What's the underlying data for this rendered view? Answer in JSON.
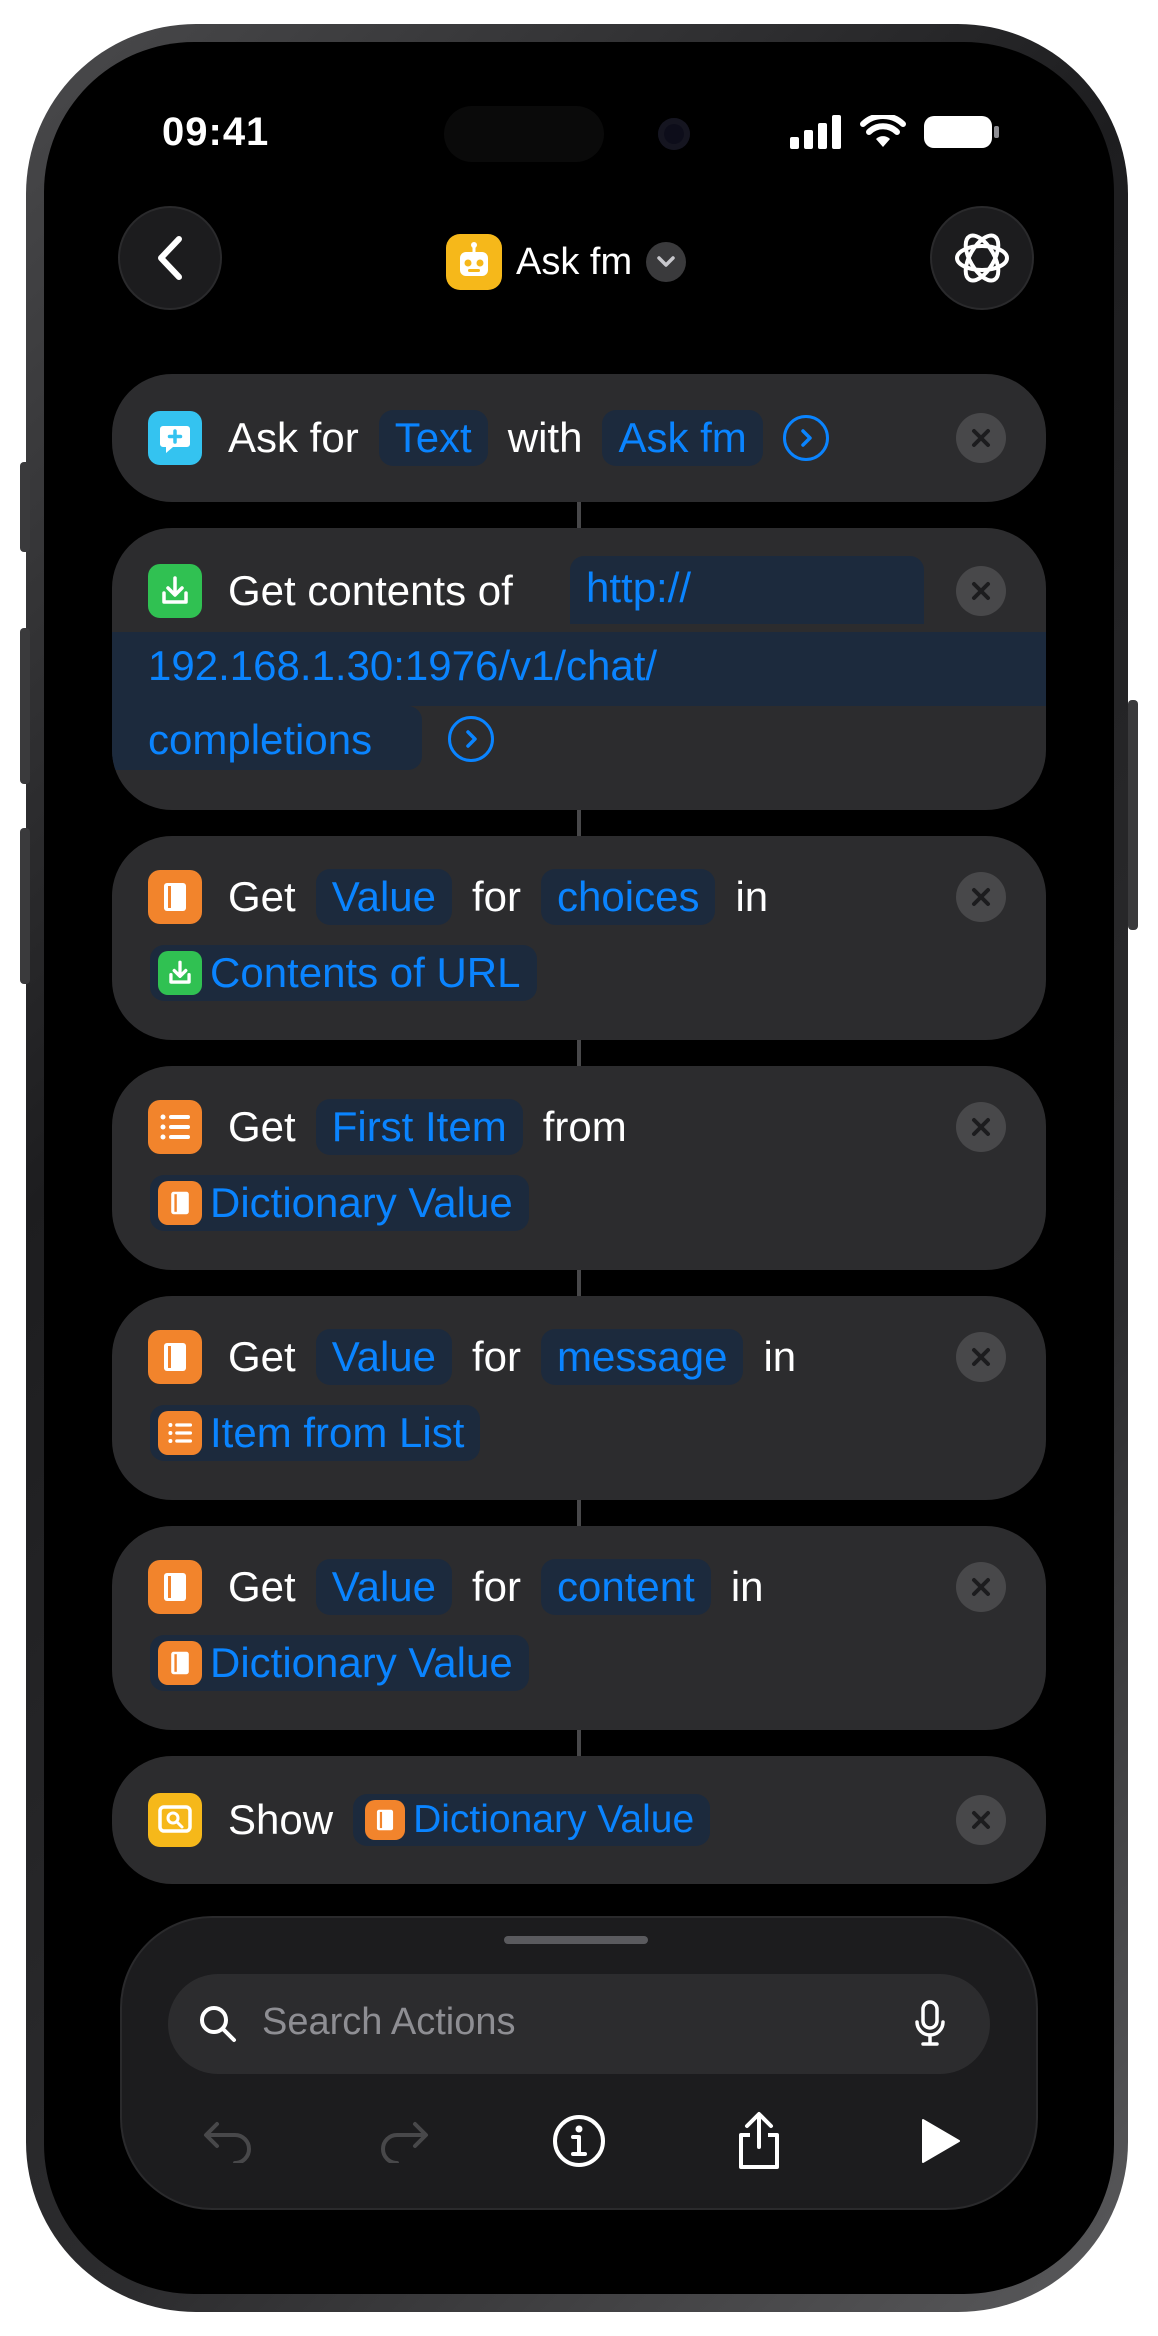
{
  "status_bar": {
    "time": "09:41"
  },
  "header": {
    "title": "Ask fm"
  },
  "actions": [
    {
      "label": "Ask for",
      "type_token": "Text",
      "joiner": "with",
      "prompt_token": "Ask fm"
    },
    {
      "label": "Get contents of",
      "url_line1": "http://",
      "url_line2": "192.168.1.30:1976/v1/chat/",
      "url_line3": "completions"
    },
    {
      "label": "Get",
      "key_type": "Value",
      "joiner": "for",
      "key": "choices",
      "in_word": "in",
      "source": "Contents of URL"
    },
    {
      "label": "Get",
      "item": "First Item",
      "joiner": "from",
      "source": "Dictionary Value"
    },
    {
      "label": "Get",
      "key_type": "Value",
      "joiner": "for",
      "key": "message",
      "in_word": "in",
      "source": "Item from List"
    },
    {
      "label": "Get",
      "key_type": "Value",
      "joiner": "for",
      "key": "content",
      "in_word": "in",
      "source": "Dictionary Value"
    },
    {
      "label": "Show",
      "source": "Dictionary Value"
    }
  ],
  "search": {
    "placeholder": "Search Actions"
  },
  "colors": {
    "accent": "#0a84ff",
    "card": "#2c2c2e",
    "orange": "#f2842c",
    "green": "#30c152",
    "cyan": "#34c3f0",
    "yellow": "#f6b81a"
  }
}
